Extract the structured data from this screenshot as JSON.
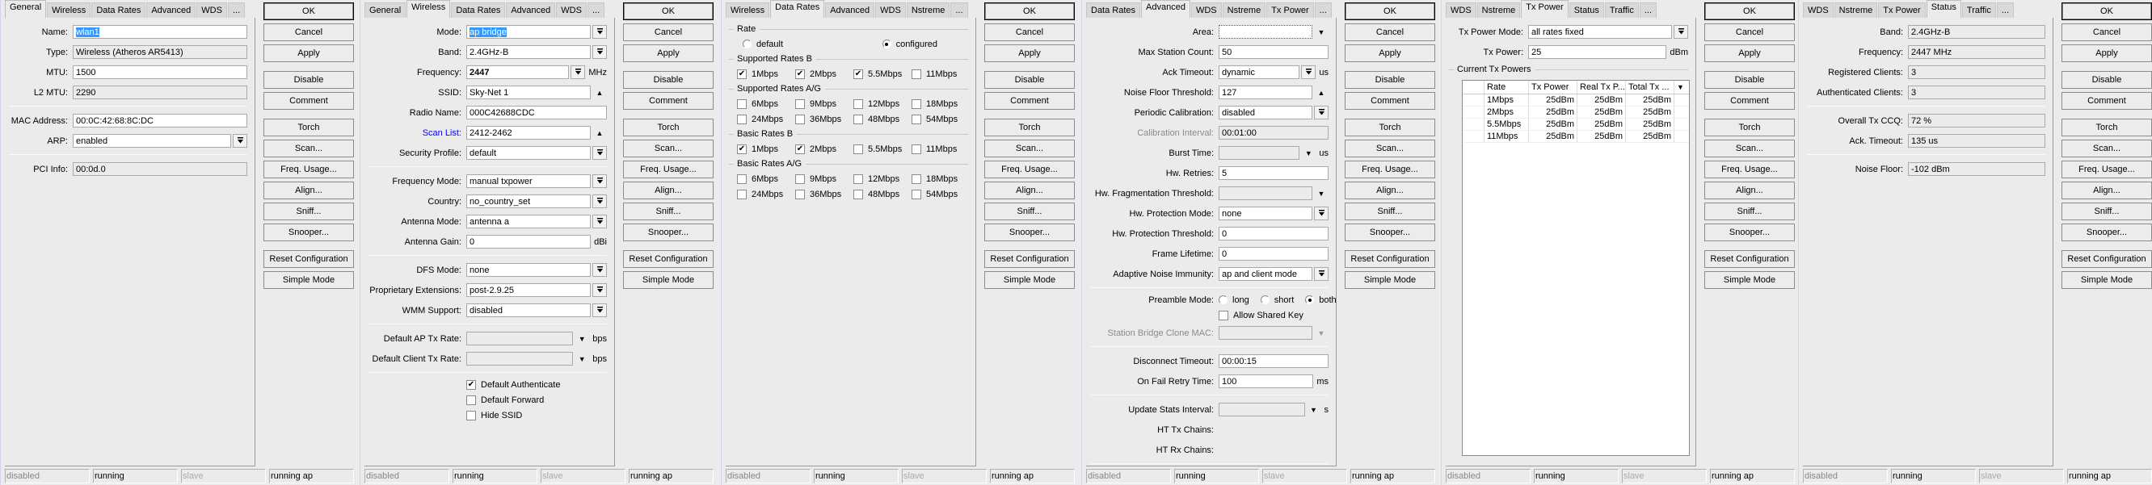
{
  "buttons": [
    "OK",
    "Cancel",
    "Apply",
    "Disable",
    "Comment",
    "Torch",
    "Scan...",
    "Freq. Usage...",
    "Align...",
    "Sniff...",
    "Snooper...",
    "Reset Configuration",
    "Simple Mode"
  ],
  "status": [
    {
      "text": "disabled",
      "tone": "gray"
    },
    {
      "text": "running",
      "tone": "normal"
    },
    {
      "text": "slave",
      "tone": "light"
    },
    {
      "text": "running ap",
      "tone": "normal"
    }
  ],
  "panels": [
    {
      "tabs": [
        "General",
        "Wireless",
        "Data Rates",
        "Advanced",
        "WDS",
        "..."
      ],
      "active": 0,
      "rows": [
        {
          "type": "text",
          "label": "Name:",
          "value": "wlan1",
          "selected": true
        },
        {
          "type": "ro",
          "label": "Type:",
          "value": "Wireless (Atheros AR5413)"
        },
        {
          "type": "text",
          "label": "MTU:",
          "value": "1500"
        },
        {
          "type": "ro",
          "label": "L2 MTU:",
          "value": "2290"
        },
        {
          "type": "sep"
        },
        {
          "type": "text",
          "label": "MAC Address:",
          "value": "00:0C:42:68:8C:DC"
        },
        {
          "type": "select",
          "label": "ARP:",
          "value": "enabled"
        },
        {
          "type": "sep"
        },
        {
          "type": "ro",
          "label": "PCI Info:",
          "value": "00:0d.0"
        }
      ]
    },
    {
      "tabs": [
        "General",
        "Wireless",
        "Data Rates",
        "Advanced",
        "WDS",
        "..."
      ],
      "active": 1,
      "rows": [
        {
          "type": "select",
          "label": "Mode:",
          "value": "ap bridge",
          "selected": true
        },
        {
          "type": "select",
          "label": "Band:",
          "value": "2.4GHz-B"
        },
        {
          "type": "select",
          "label": "Frequency:",
          "value": "2447",
          "unit": "MHz",
          "bold": true
        },
        {
          "type": "up",
          "label": "SSID:",
          "value": "Sky-Net 1"
        },
        {
          "type": "text",
          "label": "Radio Name:",
          "value": "000C42688CDC"
        },
        {
          "type": "up",
          "label": "Scan List:",
          "value": "2412-2462",
          "label_state": "link"
        },
        {
          "type": "select",
          "label": "Security Profile:",
          "value": "default"
        },
        {
          "type": "sep"
        },
        {
          "type": "select",
          "label": "Frequency Mode:",
          "value": "manual txpower"
        },
        {
          "type": "select",
          "label": "Country:",
          "value": "no_country_set"
        },
        {
          "type": "select",
          "label": "Antenna Mode:",
          "value": "antenna a"
        },
        {
          "type": "text",
          "label": "Antenna Gain:",
          "value": "0",
          "unit": "dBi"
        },
        {
          "type": "sep"
        },
        {
          "type": "select",
          "label": "DFS Mode:",
          "value": "none"
        },
        {
          "type": "select",
          "label": "Proprietary Extensions:",
          "value": "post-2.9.25"
        },
        {
          "type": "select",
          "label": "WMM Support:",
          "value": "disabled"
        },
        {
          "type": "sep"
        },
        {
          "type": "down",
          "label": "Default AP Tx Rate:",
          "value": "",
          "unit": "bps"
        },
        {
          "type": "down",
          "label": "Default Client Tx Rate:",
          "value": "",
          "unit": "bps"
        },
        {
          "type": "sep"
        },
        {
          "type": "check",
          "label": "Default Authenticate",
          "checked": true
        },
        {
          "type": "check",
          "label": "Default Forward",
          "checked": false
        },
        {
          "type": "check",
          "label": "Hide SSID",
          "checked": false
        }
      ]
    },
    {
      "tabs": [
        "Wireless",
        "Data Rates",
        "Advanced",
        "WDS",
        "Nstreme",
        "..."
      ],
      "active": 1,
      "rows": [
        {
          "type": "group",
          "label": "Rate"
        },
        {
          "type": "radios",
          "items": [
            {
              "label": "default",
              "on": false
            },
            {
              "label": "configured",
              "on": true
            }
          ]
        },
        {
          "type": "group",
          "label": "Supported Rates B"
        },
        {
          "type": "checks",
          "items": [
            {
              "label": "1Mbps",
              "checked": true
            },
            {
              "label": "2Mbps",
              "checked": true
            },
            {
              "label": "5.5Mbps",
              "checked": true
            },
            {
              "label": "11Mbps",
              "checked": false
            }
          ]
        },
        {
          "type": "group",
          "label": "Supported Rates A/G"
        },
        {
          "type": "checks",
          "items": [
            {
              "label": "6Mbps",
              "checked": false
            },
            {
              "label": "9Mbps",
              "checked": false
            },
            {
              "label": "12Mbps",
              "checked": false
            },
            {
              "label": "18Mbps",
              "checked": false
            },
            {
              "label": "24Mbps",
              "checked": false
            },
            {
              "label": "36Mbps",
              "checked": false
            },
            {
              "label": "48Mbps",
              "checked": false
            },
            {
              "label": "54Mbps",
              "checked": false
            }
          ]
        },
        {
          "type": "group",
          "label": "Basic Rates B"
        },
        {
          "type": "checks",
          "items": [
            {
              "label": "1Mbps",
              "checked": true
            },
            {
              "label": "2Mbps",
              "checked": true
            },
            {
              "label": "5.5Mbps",
              "checked": false
            },
            {
              "label": "11Mbps",
              "checked": false
            }
          ]
        },
        {
          "type": "group",
          "label": "Basic Rates A/G"
        },
        {
          "type": "checks",
          "items": [
            {
              "label": "6Mbps",
              "checked": false
            },
            {
              "label": "9Mbps",
              "checked": false
            },
            {
              "label": "12Mbps",
              "checked": false
            },
            {
              "label": "18Mbps",
              "checked": false
            },
            {
              "label": "24Mbps",
              "checked": false
            },
            {
              "label": "36Mbps",
              "checked": false
            },
            {
              "label": "48Mbps",
              "checked": false
            },
            {
              "label": "54Mbps",
              "checked": false
            }
          ]
        }
      ]
    },
    {
      "tabs": [
        "Data Rates",
        "Advanced",
        "WDS",
        "Nstreme",
        "Tx Power",
        "..."
      ],
      "active": 1,
      "rows": [
        {
          "type": "down",
          "label": "Area:",
          "value": "",
          "white": true
        },
        {
          "type": "text",
          "label": "Max Station Count:",
          "value": "50"
        },
        {
          "type": "select",
          "label": "Ack Timeout:",
          "value": "dynamic",
          "unit": "us"
        },
        {
          "type": "up",
          "label": "Noise Floor Threshold:",
          "value": "127"
        },
        {
          "type": "select",
          "label": "Periodic Calibration:",
          "value": "disabled"
        },
        {
          "type": "ro",
          "label": "Calibration Interval:",
          "value": "00:01:00",
          "label_state": "disabled"
        },
        {
          "type": "down",
          "label": "Burst Time:",
          "value": "",
          "unit": "us"
        },
        {
          "type": "text",
          "label": "Hw. Retries:",
          "value": "5"
        },
        {
          "type": "down",
          "label": "Hw. Fragmentation Threshold:",
          "value": ""
        },
        {
          "type": "select",
          "label": "Hw. Protection Mode:",
          "value": "none"
        },
        {
          "type": "text",
          "label": "Hw. Protection Threshold:",
          "value": "0"
        },
        {
          "type": "text",
          "label": "Frame Lifetime:",
          "value": "0"
        },
        {
          "type": "select",
          "label": "Adaptive Noise Immunity:",
          "value": "ap and client mode"
        },
        {
          "type": "sep"
        },
        {
          "type": "radio",
          "label": "Preamble Mode:",
          "items": [
            {
              "label": "long",
              "on": false
            },
            {
              "label": "short",
              "on": false
            },
            {
              "label": "both",
              "on": true
            }
          ]
        },
        {
          "type": "check",
          "label": "Allow Shared Key",
          "checked": false
        },
        {
          "type": "down",
          "label": "Station Bridge Clone MAC:",
          "value": "",
          "label_state": "disabled",
          "disabled": true
        },
        {
          "type": "sep"
        },
        {
          "type": "text",
          "label": "Disconnect Timeout:",
          "value": "00:00:15"
        },
        {
          "type": "text",
          "label": "On Fail Retry Time:",
          "value": "100",
          "unit": "ms"
        },
        {
          "type": "sep"
        },
        {
          "type": "down",
          "label": "Update Stats Interval:",
          "value": "",
          "unit": "s"
        },
        {
          "type": "label",
          "label": "HT Tx Chains:"
        },
        {
          "type": "label",
          "label": "HT Rx Chains:"
        },
        {
          "type": "sep"
        }
      ]
    },
    {
      "tabs": [
        "WDS",
        "Nstreme",
        "Tx Power",
        "Status",
        "Traffic",
        "..."
      ],
      "active": 2,
      "rows": [
        {
          "type": "select",
          "label": "Tx Power Mode:",
          "value": "all rates fixed"
        },
        {
          "type": "text",
          "label": "Tx Power:",
          "value": "25",
          "unit": "dBm"
        },
        {
          "type": "group",
          "label": "Current Tx Powers"
        },
        {
          "type": "table",
          "columns": [
            "",
            "Rate",
            "Tx Power",
            "Real Tx P...",
            "Total Tx ..."
          ],
          "rows": [
            [
              "",
              "1Mbps",
              "25dBm",
              "25dBm",
              "25dBm"
            ],
            [
              "",
              "2Mbps",
              "25dBm",
              "25dBm",
              "25dBm"
            ],
            [
              "",
              "5.5Mbps",
              "25dBm",
              "25dBm",
              "25dBm"
            ],
            [
              "",
              "11Mbps",
              "25dBm",
              "25dBm",
              "25dBm"
            ]
          ]
        }
      ]
    },
    {
      "tabs": [
        "WDS",
        "Nstreme",
        "Tx Power",
        "Status",
        "Traffic",
        "..."
      ],
      "active": 3,
      "rows": [
        {
          "type": "ro",
          "label": "Band:",
          "value": "2.4GHz-B"
        },
        {
          "type": "ro",
          "label": "Frequency:",
          "value": "2447 MHz"
        },
        {
          "type": "ro",
          "label": "Registered Clients:",
          "value": "3"
        },
        {
          "type": "ro",
          "label": "Authenticated Clients:",
          "value": "3"
        },
        {
          "type": "sep"
        },
        {
          "type": "ro",
          "label": "Overall Tx CCQ:",
          "value": "72 %"
        },
        {
          "type": "ro",
          "label": "Ack. Timeout:",
          "value": "135 us"
        },
        {
          "type": "sep"
        },
        {
          "type": "ro",
          "label": "Noise Floor:",
          "value": "-102 dBm"
        }
      ]
    }
  ]
}
